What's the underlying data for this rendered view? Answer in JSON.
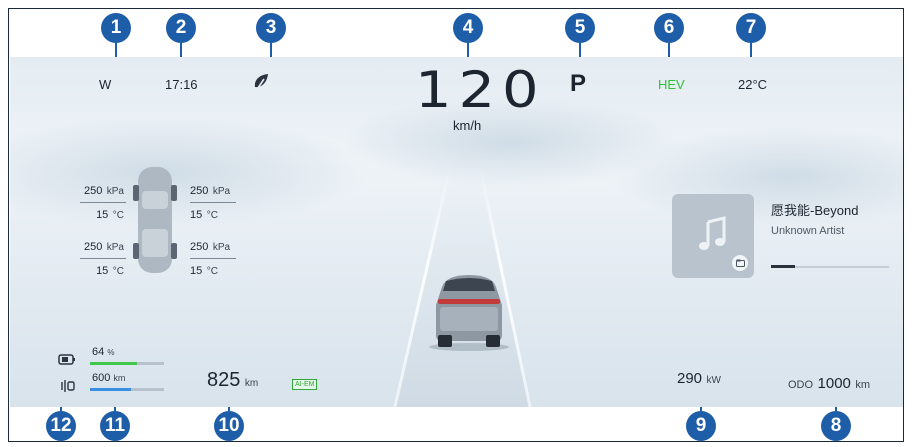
{
  "top_bar": {
    "direction": "W",
    "time": "17:16",
    "eco_icon": "leaf-icon",
    "gear": "P",
    "drive_mode": "HEV",
    "drive_mode_color": "#2fc13a",
    "temperature": "22°C"
  },
  "speed": {
    "value": "120",
    "unit": "km/h"
  },
  "tires": [
    {
      "pressure": "250",
      "pressure_unit": "kPa",
      "temp": "15",
      "temp_unit": "°C"
    },
    {
      "pressure": "250",
      "pressure_unit": "kPa",
      "temp": "15",
      "temp_unit": "°C"
    },
    {
      "pressure": "250",
      "pressure_unit": "kPa",
      "temp": "15",
      "temp_unit": "°C"
    },
    {
      "pressure": "250",
      "pressure_unit": "kPa",
      "temp": "15",
      "temp_unit": "°C"
    }
  ],
  "media": {
    "title": "愿我能-Beyond",
    "artist": "Unknown Artist",
    "progress": 0.2,
    "cover_icon": "music-note-icon"
  },
  "battery": {
    "percent": "64",
    "unit": "%",
    "level": 0.64,
    "color": "#3fc84a"
  },
  "ev_range": {
    "value": "600",
    "unit": "km",
    "level": 0.55,
    "color": "#3b8fe0"
  },
  "range": {
    "value": "825",
    "unit": "km",
    "mode_tag": "AI-EM"
  },
  "power": {
    "value": "290",
    "unit": "kW"
  },
  "odometer": {
    "label": "ODO",
    "value": "1000",
    "unit": "km"
  },
  "callouts": [
    "1",
    "2",
    "3",
    "4",
    "5",
    "6",
    "7",
    "8",
    "9",
    "10",
    "11",
    "12"
  ]
}
